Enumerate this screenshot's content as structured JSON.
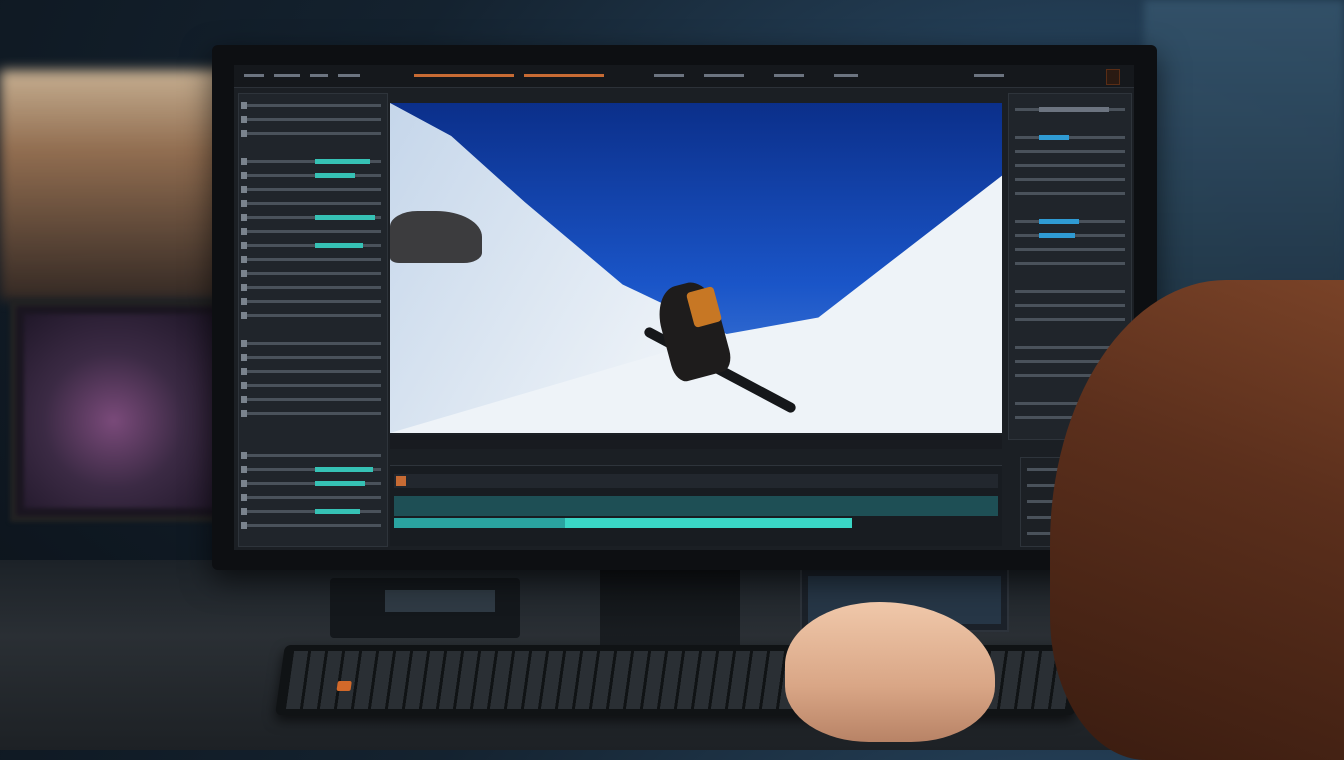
{
  "scene": {
    "description_tags": [
      "desk",
      "monitor",
      "video-editor",
      "keyboard",
      "hand"
    ],
    "colors": {
      "accent_orange": "#c76b34",
      "accent_cyan": "#36c2b5",
      "sky_blue": "#1a55c8",
      "snow": "#eef3f8"
    }
  },
  "app": {
    "badge_text": ""
  },
  "icons": {
    "menu": "menu-icon",
    "play": "play-icon"
  }
}
